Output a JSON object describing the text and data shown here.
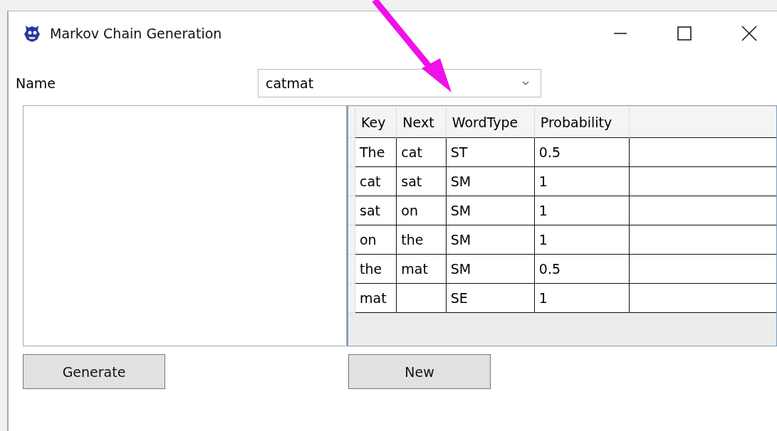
{
  "window": {
    "title": "Markov Chain Generation"
  },
  "name_field": {
    "label": "Name",
    "value": "catmat"
  },
  "table": {
    "columns": [
      "Key",
      "Next",
      "WordType",
      "Probability"
    ],
    "rows": [
      {
        "key": "The",
        "next": "cat",
        "word_type": "ST",
        "probability": "0.5"
      },
      {
        "key": "cat",
        "next": "sat",
        "word_type": "SM",
        "probability": "1"
      },
      {
        "key": "sat",
        "next": "on",
        "word_type": "SM",
        "probability": "1"
      },
      {
        "key": "on",
        "next": "the",
        "word_type": "SM",
        "probability": "1"
      },
      {
        "key": "the",
        "next": "mat",
        "word_type": "SM",
        "probability": "0.5"
      },
      {
        "key": "mat",
        "word_type": "SE",
        "probability": "1"
      }
    ]
  },
  "buttons": [
    "Generate",
    "New"
  ]
}
